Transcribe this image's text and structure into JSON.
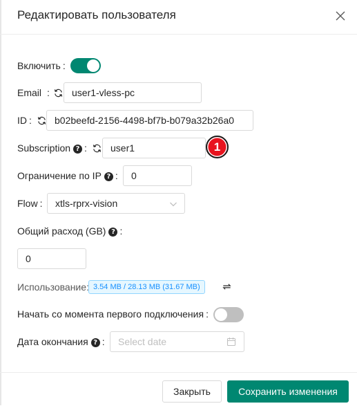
{
  "modal": {
    "title": "Редактировать пользователя"
  },
  "form": {
    "enable": {
      "label": "Включить",
      "colon": ":",
      "value": true
    },
    "email": {
      "label": "Email",
      "colon": ":",
      "value": "user1-vless-pc"
    },
    "id": {
      "label": "ID",
      "colon": ":",
      "value": "b02beefd-2156-4498-bf7b-b079a32b26a0"
    },
    "subscription": {
      "label": "Subscription",
      "help": "?",
      "colon": ":",
      "value": "user1"
    },
    "ip_limit": {
      "label": "Ограничение по IP",
      "help": "?",
      "colon": ":",
      "value": "0"
    },
    "flow": {
      "label": "Flow",
      "colon": ":",
      "value": "xtls-rprx-vision"
    },
    "total_gb": {
      "label": "Общий расход (GB)",
      "help": "?",
      "colon": ":",
      "value": "0"
    },
    "usage": {
      "label": "Использование:",
      "value": "3.54 MB / 28.13 MB (31.67 MB)"
    },
    "start_after_first_use": {
      "label": "Начать со момента первого подключения",
      "colon": ":",
      "value": false
    },
    "expiry": {
      "label": "Дата окончания",
      "help": "?",
      "colon": ":",
      "placeholder": "Select date"
    }
  },
  "annotation": {
    "step": "1",
    "color": "#e8131e"
  },
  "footer": {
    "close_label": "Закрыть",
    "save_label": "Сохранить изменения"
  },
  "colors": {
    "primary": "#008771",
    "usage_badge": "#1890ff"
  },
  "icons": [
    "close-icon",
    "sync-icon",
    "help-icon",
    "chevron-down-icon",
    "calendar-icon",
    "reset-traffic-icon"
  ]
}
